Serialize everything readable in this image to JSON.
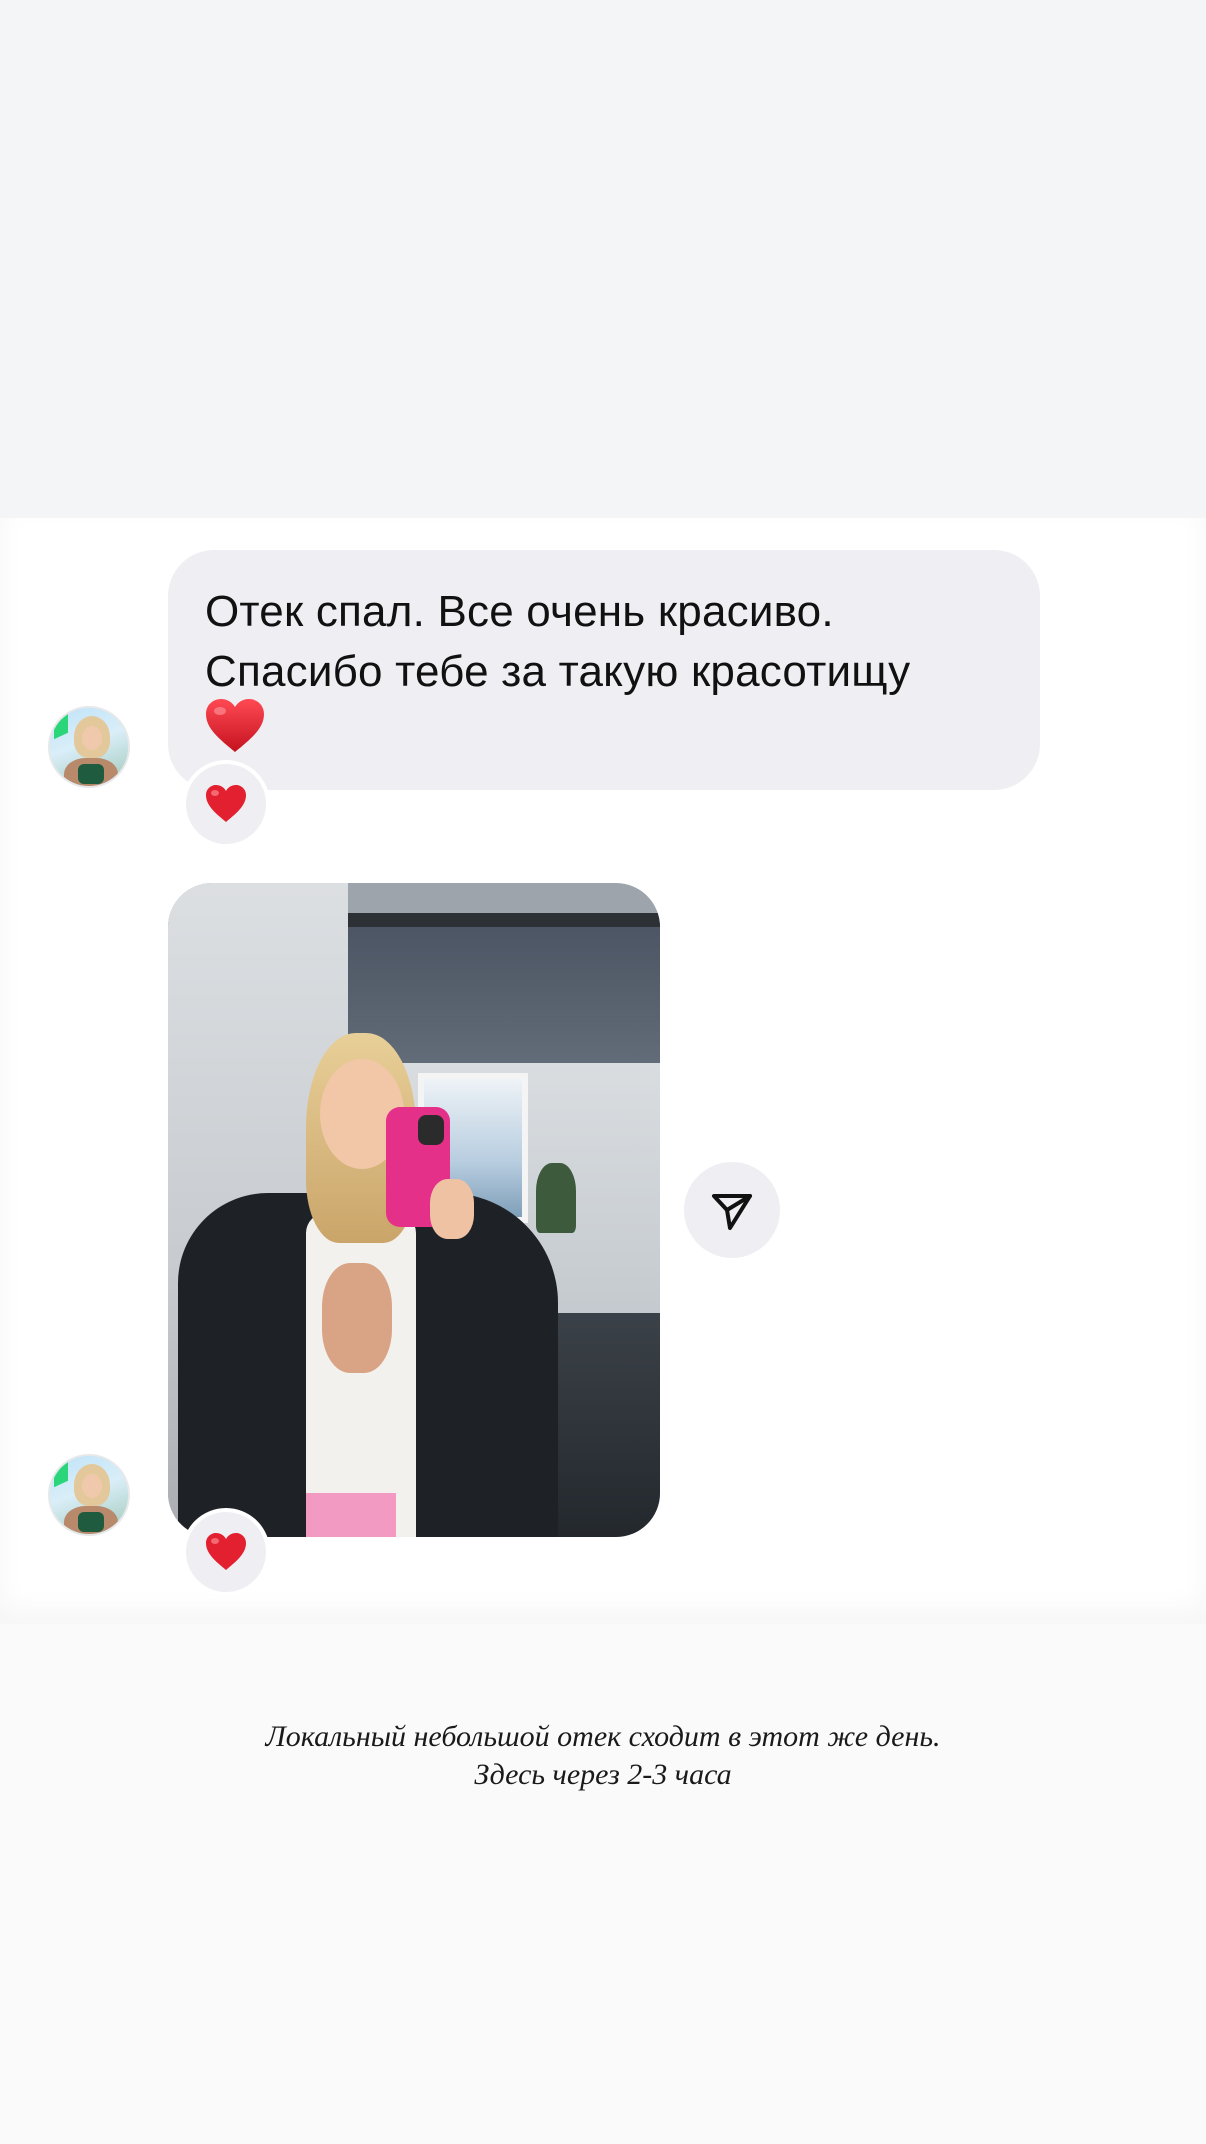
{
  "messages": [
    {
      "type": "text",
      "text": "Отек спал. Все очень красиво.\nСпасибо тебе за такую красотищу",
      "emoji": "heart-emoji",
      "reaction": "heart-emoji"
    },
    {
      "type": "photo",
      "image": "mirror-selfie-photo",
      "reaction": "heart-emoji",
      "action": "share-icon"
    }
  ],
  "caption": {
    "line1": "Локальный небольшой отек сходит в этот же день.",
    "line2": "Здесь через 2-3 часа"
  },
  "colors": {
    "bubble": "#efeff3",
    "heart": "#e0202e",
    "page_top": "#f4f5f6",
    "chat_bg": "#ffffff"
  }
}
